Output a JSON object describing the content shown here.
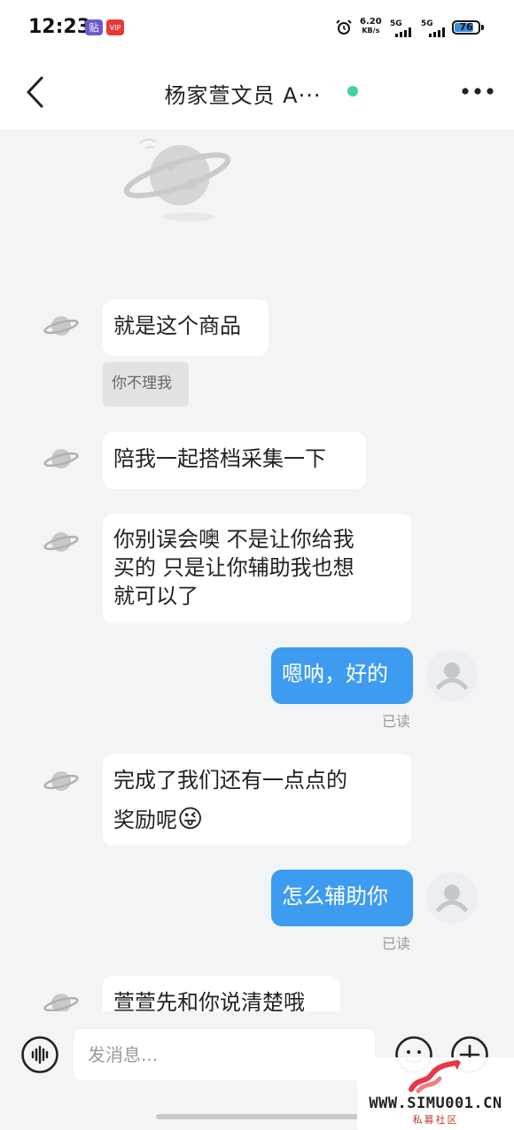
{
  "status_bar": {
    "time": "12:23",
    "app_icons": [
      "贴",
      "VIP"
    ],
    "net_speed_value": "6.20",
    "net_speed_unit": "KB/s",
    "signal_1": "5G",
    "signal_2": "5G",
    "battery": "76"
  },
  "header": {
    "title": "杨家萱文员 A···",
    "online_color": "#3fd3a3"
  },
  "messages": [
    {
      "side": "in",
      "text": "就是这个商品"
    },
    {
      "side": "system",
      "text": "你不理我"
    },
    {
      "side": "in",
      "text": "陪我一起搭档采集一下"
    },
    {
      "side": "in",
      "lines": [
        "你别误会噢 不是让你给我",
        "买的 只是让你辅助我也想",
        "就可以了"
      ]
    },
    {
      "side": "out",
      "text": "嗯呐，好的",
      "status": "已读"
    },
    {
      "side": "in",
      "lines": [
        "完成了我们还有一点点的",
        "奖励呢"
      ],
      "emoji": "😜"
    },
    {
      "side": "out",
      "text": "怎么辅助你",
      "status": "已读"
    },
    {
      "side": "in",
      "text": "萱萱先和你说清楚哦"
    }
  ],
  "input": {
    "placeholder": "发消息..."
  },
  "watermark": {
    "url": "WWW.SIMU001.CN",
    "sub": "私募社区"
  },
  "colors": {
    "outgoing_bubble": "#3d9bf0",
    "incoming_bubble": "#ffffff",
    "background": "#f3f4f6"
  }
}
